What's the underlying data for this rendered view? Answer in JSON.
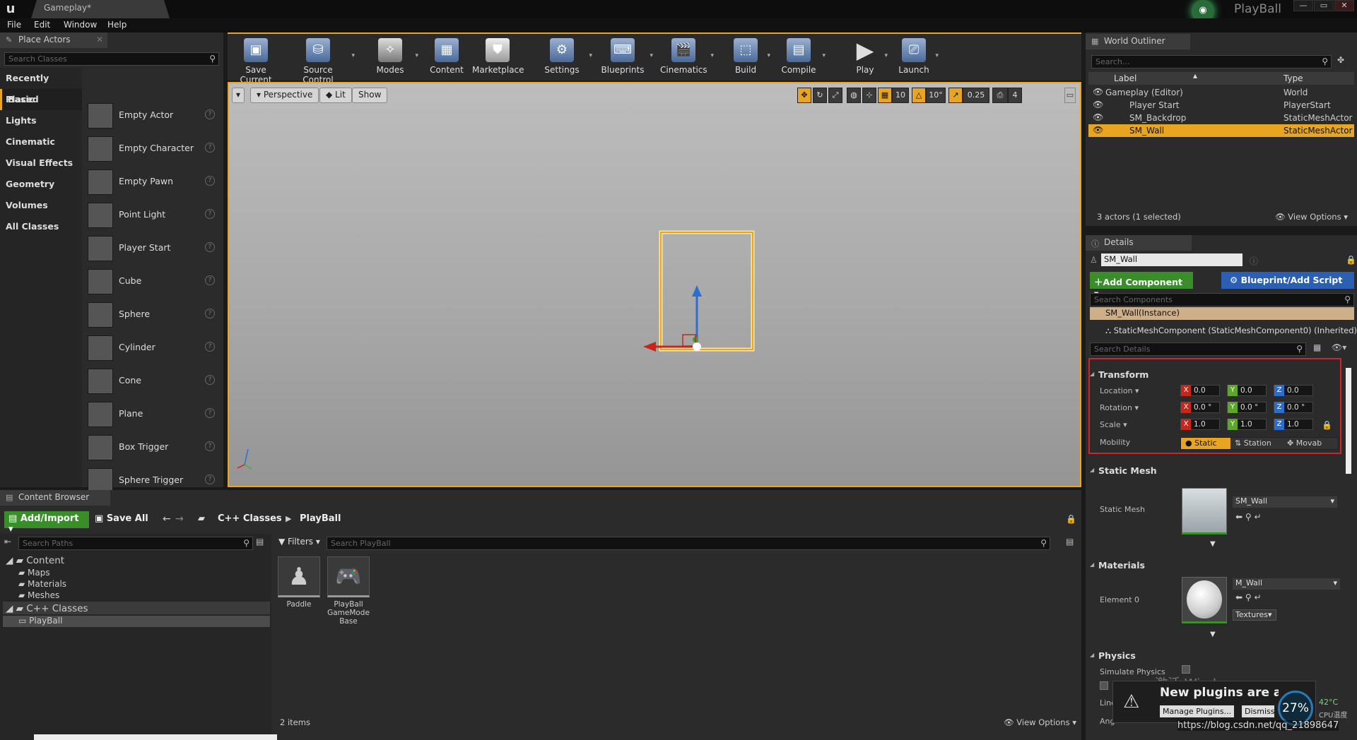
{
  "titlebar": {
    "tab_label": "Gameplay*",
    "project_name": "PlayBall",
    "logo_text": "u",
    "window_buttons": [
      "—",
      "▭",
      "✕"
    ]
  },
  "menubar": {
    "items": [
      "File",
      "Edit",
      "Window",
      "Help"
    ]
  },
  "place_actors": {
    "tab_label": "Place Actors",
    "search_placeholder": "Search Classes",
    "categories": [
      "Recently Placed",
      "Basic",
      "Lights",
      "Cinematic",
      "Visual Effects",
      "Geometry",
      "Volumes",
      "All Classes"
    ],
    "selected_category": "Basic",
    "items": [
      "Empty Actor",
      "Empty Character",
      "Empty Pawn",
      "Point Light",
      "Player Start",
      "Cube",
      "Sphere",
      "Cylinder",
      "Cone",
      "Plane",
      "Box Trigger",
      "Sphere Trigger"
    ]
  },
  "toolbar": {
    "buttons": [
      "Save Current",
      "Source Control",
      "Modes",
      "Content",
      "Marketplace",
      "Settings",
      "Blueprints",
      "Cinematics",
      "Build",
      "Compile",
      "Play",
      "Launch"
    ]
  },
  "viewport": {
    "perspective": "Perspective",
    "lit": "Lit",
    "show": "Show",
    "grid_snap": "10",
    "rotation_snap": "10°",
    "scale_snap": "0.25",
    "camera_speed": "4"
  },
  "outliner": {
    "tab_label": "World Outliner",
    "search_placeholder": "Search...",
    "col_label": "Label",
    "col_type": "Type",
    "rows": [
      {
        "label": "Gameplay (Editor)",
        "type": "World"
      },
      {
        "label": "Player Start",
        "type": "PlayerStart"
      },
      {
        "label": "SM_Backdrop",
        "type": "StaticMeshActor"
      },
      {
        "label": "SM_Wall",
        "type": "StaticMeshActor"
      }
    ],
    "status": "3 actors (1 selected)",
    "view_options": "View Options"
  },
  "details": {
    "tab_label": "Details",
    "name": "SM_Wall",
    "add_component": "Add Component",
    "blueprint": "Blueprint/Add Script",
    "search_components": "Search Components",
    "instance": "SM_Wall(Instance)",
    "component": "StaticMeshComponent (StaticMeshComponent0) (Inherited)",
    "search_details": "Search Details",
    "transform": {
      "title": "Transform",
      "location_label": "Location",
      "rotation_label": "Rotation",
      "scale_label": "Scale",
      "mobility_label": "Mobility",
      "location": [
        "0.0",
        "0.0",
        "0.0"
      ],
      "rotation": [
        "0.0 °",
        "0.0 °",
        "0.0 °"
      ],
      "scale": [
        "1.0",
        "1.0",
        "1.0"
      ],
      "mobility": [
        "Static",
        "Station",
        "Movab"
      ]
    },
    "static_mesh": {
      "title": "Static Mesh",
      "label": "Static Mesh",
      "value": "SM_Wall"
    },
    "materials": {
      "title": "Materials",
      "label": "Element 0",
      "value": "M_Wall",
      "textures": "Textures"
    },
    "physics": {
      "title": "Physics",
      "simulate": "Simulate Physics",
      "line": "Line",
      "ang": "Ang"
    }
  },
  "content_browser": {
    "tab_label": "Content Browser",
    "add_import": "Add/Import",
    "save_all": "Save All",
    "path": [
      "C++ Classes",
      "PlayBall"
    ],
    "search_paths": "Search Paths",
    "filters": "Filters",
    "search_assets": "Search PlayBall",
    "tree": [
      "Content",
      "Maps",
      "Materials",
      "Meshes",
      "C++ Classes",
      "PlayBall"
    ],
    "assets": [
      {
        "name": "Paddle"
      },
      {
        "name": "PlayBall GameMode Base"
      }
    ],
    "count": "2 items",
    "view_options": "View Options"
  },
  "notification": {
    "text": "New plugins are available",
    "manage": "Manage Plugins...",
    "dismiss": "Dismiss",
    "watermark": "激活 Windows",
    "cpu_percent": "27%",
    "cpu_temp": "42°C",
    "cpu_label": "CPU温度",
    "url": "https://blog.csdn.net/qq_21898647"
  }
}
